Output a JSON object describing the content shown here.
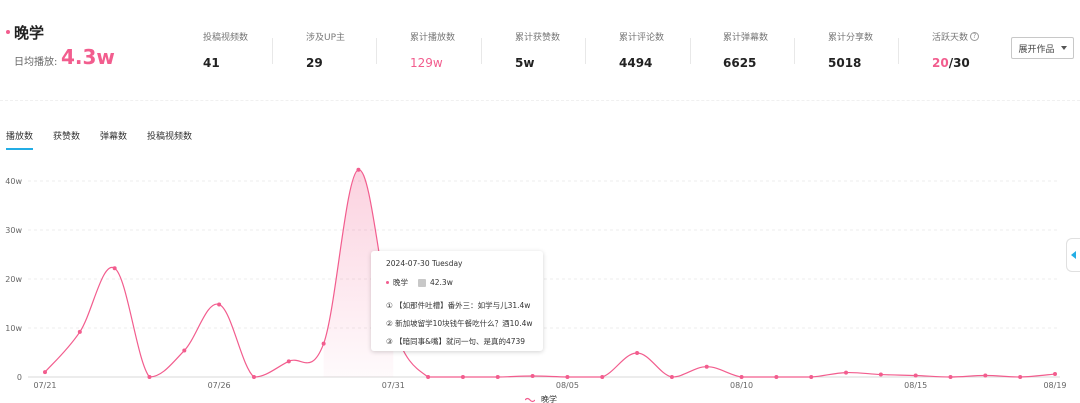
{
  "header": {
    "title": "晚学",
    "daily_label": "日均播放:",
    "daily_value": "4.3w"
  },
  "stats": [
    {
      "label": "投稿视频数",
      "value": "41"
    },
    {
      "label": "涉及UP主",
      "value": "29"
    },
    {
      "label": "累计播放数",
      "value": "129w",
      "highlight": true
    },
    {
      "label": "累计获赞数",
      "value": "5w"
    },
    {
      "label": "累计评论数",
      "value": "4494"
    },
    {
      "label": "累计弹幕数",
      "value": "6625"
    },
    {
      "label": "累计分享数",
      "value": "5018"
    }
  ],
  "active_days": {
    "label": "活跃天数",
    "value_a": "20",
    "value_b": "/30"
  },
  "expand_button": "展开作品",
  "tabs": [
    {
      "label": "播放数",
      "active": true
    },
    {
      "label": "获赞数",
      "active": false
    },
    {
      "label": "弹幕数",
      "active": false
    },
    {
      "label": "投稿视频数",
      "active": false
    }
  ],
  "tooltip": {
    "date": "2024-07-30 Tuesday",
    "series_name": "晚学",
    "series_value": "42.3w",
    "items": [
      "① 【如那件吐槽】番外三：如学与儿31.4w",
      "② 新加坡留学10块钱午餐吃什么？酒10.4w",
      "③ 【暗同事&嘴】就问一句、是真的4739"
    ]
  },
  "colors": {
    "accent": "#f25d8e",
    "tab_active": "#23ade5"
  },
  "chart_data": {
    "type": "line",
    "title": "",
    "xlabel": "",
    "ylabel": "",
    "x": [
      "07/21",
      "07/22",
      "07/23",
      "07/24",
      "07/25",
      "07/26",
      "07/27",
      "07/28",
      "07/29",
      "07/30",
      "07/31",
      "08/01",
      "08/02",
      "08/03",
      "08/04",
      "08/05",
      "08/06",
      "08/07",
      "08/08",
      "08/09",
      "08/10",
      "08/11",
      "08/12",
      "08/13",
      "08/14",
      "08/15",
      "08/16",
      "08/17",
      "08/18",
      "08/19"
    ],
    "x_tick_labels": [
      "07/21",
      "07/26",
      "07/31",
      "08/05",
      "08/10",
      "08/15",
      "08/19"
    ],
    "y_ticks": [
      0,
      10,
      20,
      30,
      40
    ],
    "y_tick_labels": [
      "0",
      "10w",
      "20w",
      "30w",
      "40w"
    ],
    "y_unit": "w",
    "ylim": [
      0,
      45
    ],
    "series": [
      {
        "name": "晚学",
        "color": "#f25d8e",
        "values": [
          1.0,
          9.2,
          22.2,
          0.0,
          5.4,
          14.8,
          0.0,
          3.2,
          6.8,
          42.3,
          10.4,
          0.0,
          0.0,
          0.0,
          0.2,
          0.0,
          0.0,
          4.9,
          0.0,
          2.1,
          0.0,
          0.0,
          0.0,
          0.9,
          0.5,
          0.3,
          0.0,
          0.3,
          0.0,
          0.6
        ]
      }
    ],
    "legend_position": "bottom-center"
  }
}
